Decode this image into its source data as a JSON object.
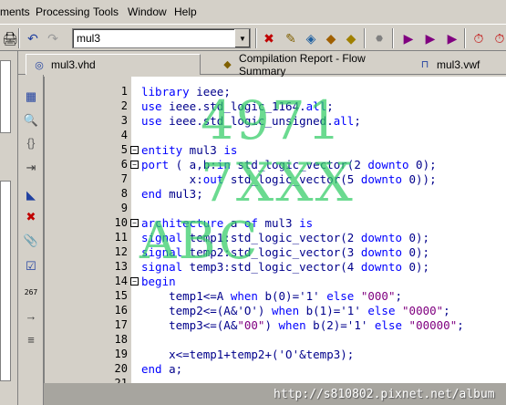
{
  "menu": [
    "ments",
    "Processing",
    "Tools",
    "Window",
    "Help"
  ],
  "toolbar": {
    "combo_value": "mul3"
  },
  "tabs": [
    {
      "label": "mul3.vhd",
      "icon": "vhdl-file-icon"
    },
    {
      "label": "Compilation Report - Flow Summary",
      "icon": "report-icon"
    },
    {
      "label": "mul3.vwf",
      "icon": "waveform-icon"
    }
  ],
  "code_lines": [
    {
      "num": "1",
      "text": "library ieee;"
    },
    {
      "num": "2",
      "text": "use ieee.std_logic_1164.all;"
    },
    {
      "num": "3",
      "text": "use ieee.std_logic_unsigned.all;"
    },
    {
      "num": "4",
      "text": ""
    },
    {
      "num": "5",
      "text": "entity mul3 is"
    },
    {
      "num": "6",
      "text": "port ( a,b:in std_logic_vector(2 downto 0);"
    },
    {
      "num": "7",
      "text": "       x:out std_logic_vector(5 downto 0));"
    },
    {
      "num": "8",
      "text": "end mul3;"
    },
    {
      "num": "9",
      "text": ""
    },
    {
      "num": "10",
      "text": "architecture a of mul3 is"
    },
    {
      "num": "11",
      "text": "signal temp1:std_logic_vector(2 downto 0);"
    },
    {
      "num": "12",
      "text": "signal temp2:std_logic_vector(3 downto 0);"
    },
    {
      "num": "13",
      "text": "signal temp3:std_logic_vector(4 downto 0);"
    },
    {
      "num": "14",
      "text": "begin"
    },
    {
      "num": "15",
      "text": "    temp1<=A when b(0)='1' else \"000\";"
    },
    {
      "num": "16",
      "text": "    temp2<=(A&'O') when b(1)='1' else \"0000\";"
    },
    {
      "num": "17",
      "text": "    temp3<=(A&\"00\") when b(2)='1' else \"00000\";"
    },
    {
      "num": "18",
      "text": ""
    },
    {
      "num": "19",
      "text": "    x<=temp1+temp2+('O'&temp3);"
    },
    {
      "num": "20",
      "text": "end a;"
    },
    {
      "num": "21",
      "text": ""
    }
  ],
  "watermark": {
    "line1": "4971 7XXX",
    "line2": "ABC",
    "url": "http://s810802.pixnet.net/album"
  },
  "colors": {
    "chrome": "#d4d0c8",
    "keyword": "#0000ff",
    "string": "#800080",
    "watermark": "#33cc66"
  }
}
